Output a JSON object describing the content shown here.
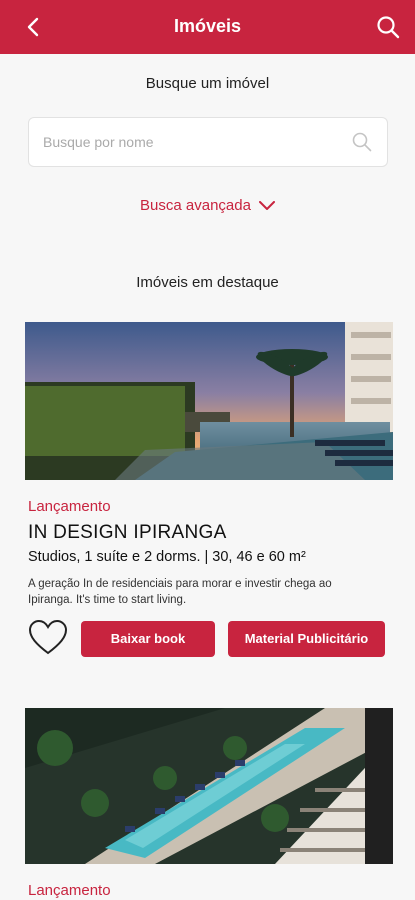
{
  "header": {
    "title": "Imóveis",
    "back_icon": "chevron-left-icon",
    "search_icon": "search-icon"
  },
  "search": {
    "section_title": "Busque um imóvel",
    "placeholder": "Busque por nome",
    "advanced_label": "Busca avançada"
  },
  "featured": {
    "section_title": "Imóveis em destaque",
    "items": [
      {
        "tag": "Lançamento",
        "name": "IN DESIGN IPIRANGA",
        "info": "Studios, 1 suíte e 2 dorms. | 30, 46 e 60 m²",
        "description": "A geração In de residenciais para morar e investir chega ao Ipiranga. It's time to start living.",
        "download_label": "Baixar book",
        "material_label": "Material Publicitário"
      },
      {
        "tag": "Lançamento"
      }
    ]
  },
  "colors": {
    "brand": "#c8243f"
  }
}
